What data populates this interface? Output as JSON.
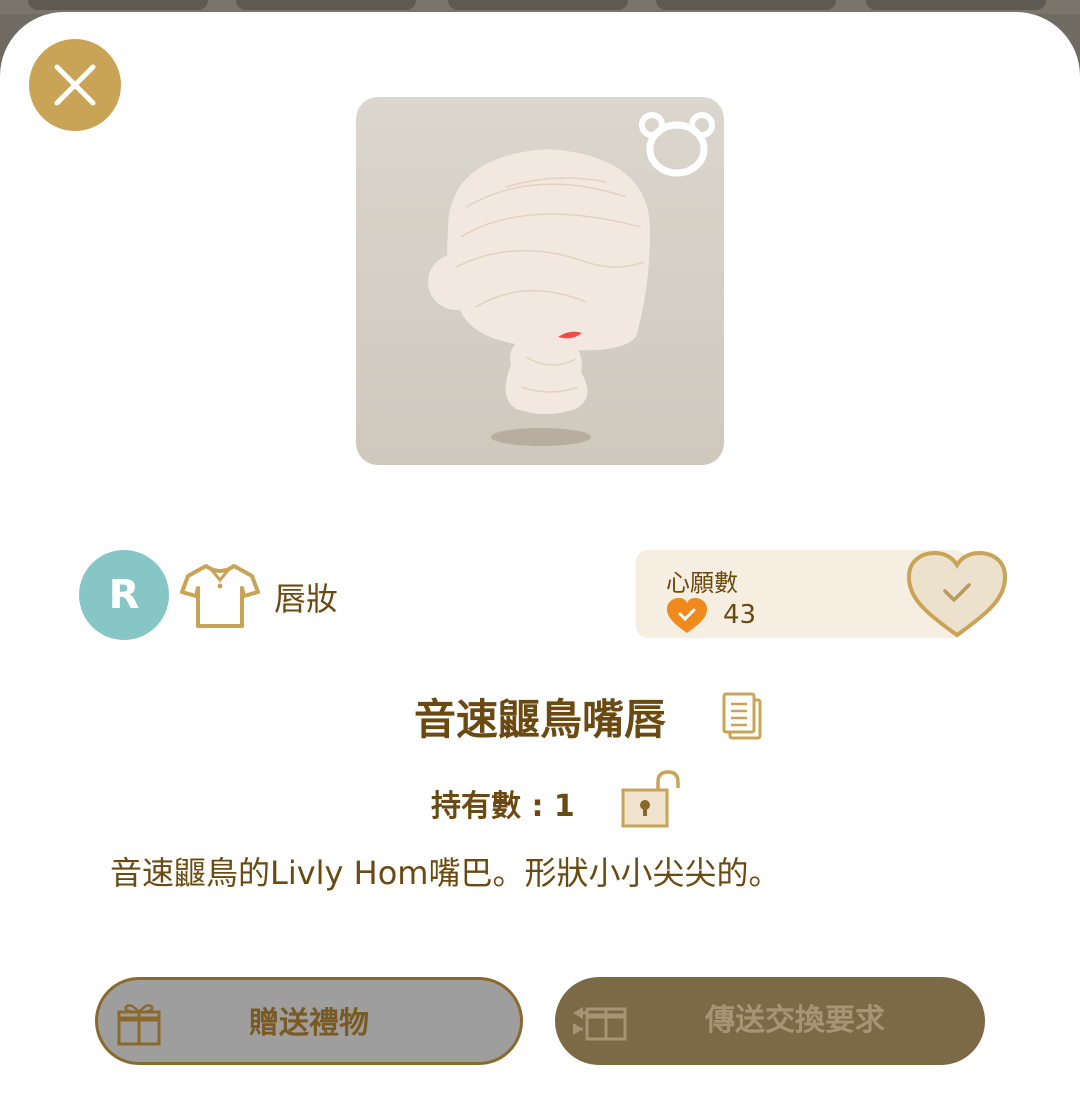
{
  "colors": {
    "accent_gold": "#c9a456",
    "text_brown": "#6b4a12",
    "rarity_teal": "#86c7c6",
    "wish_orange": "#f08a1c",
    "wish_bg": "#f6efe1"
  },
  "item": {
    "rarity": "R",
    "category_icon": "shirt-icon",
    "category": "唇妝",
    "name": "音速鼴鳥嘴唇",
    "owned": "持有數 : 1",
    "description": "音速鼴鳥的Livly Hom嘴巴。形狀小小尖尖的。"
  },
  "wishlist": {
    "title": "心願數",
    "count": "43"
  },
  "buttons": {
    "gift_label": "贈送禮物",
    "trade_label": "傳送交換要求"
  }
}
